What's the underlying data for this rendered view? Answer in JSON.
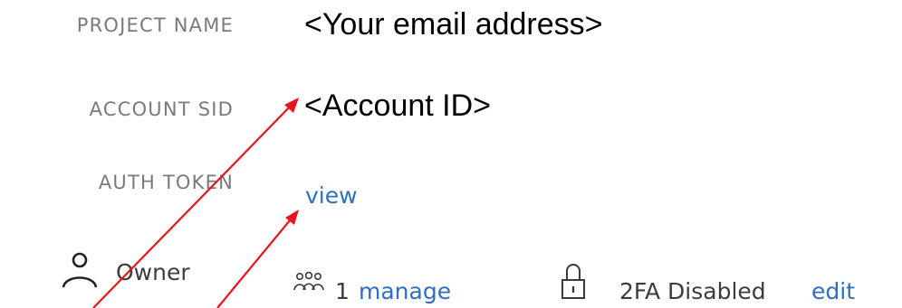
{
  "fields": {
    "project_name_label": "PROJECT NAME",
    "project_name_value": "<Your email address>",
    "account_sid_label": "ACCOUNT SID",
    "account_sid_value": "<Account ID>",
    "auth_token_label": "AUTH TOKEN",
    "auth_token_link": "view"
  },
  "meta": {
    "owner_label": "Owner",
    "members_count": "1",
    "manage_link": "manage",
    "twofa_status": "2FA Disabled",
    "edit_link": "edit"
  },
  "icons": {
    "owner": "user-icon",
    "members": "users-icon",
    "twofa": "lock-icon"
  },
  "colors": {
    "label": "#777a80",
    "link": "#2f6fc2",
    "annotation_arrow": "#e8141c"
  }
}
